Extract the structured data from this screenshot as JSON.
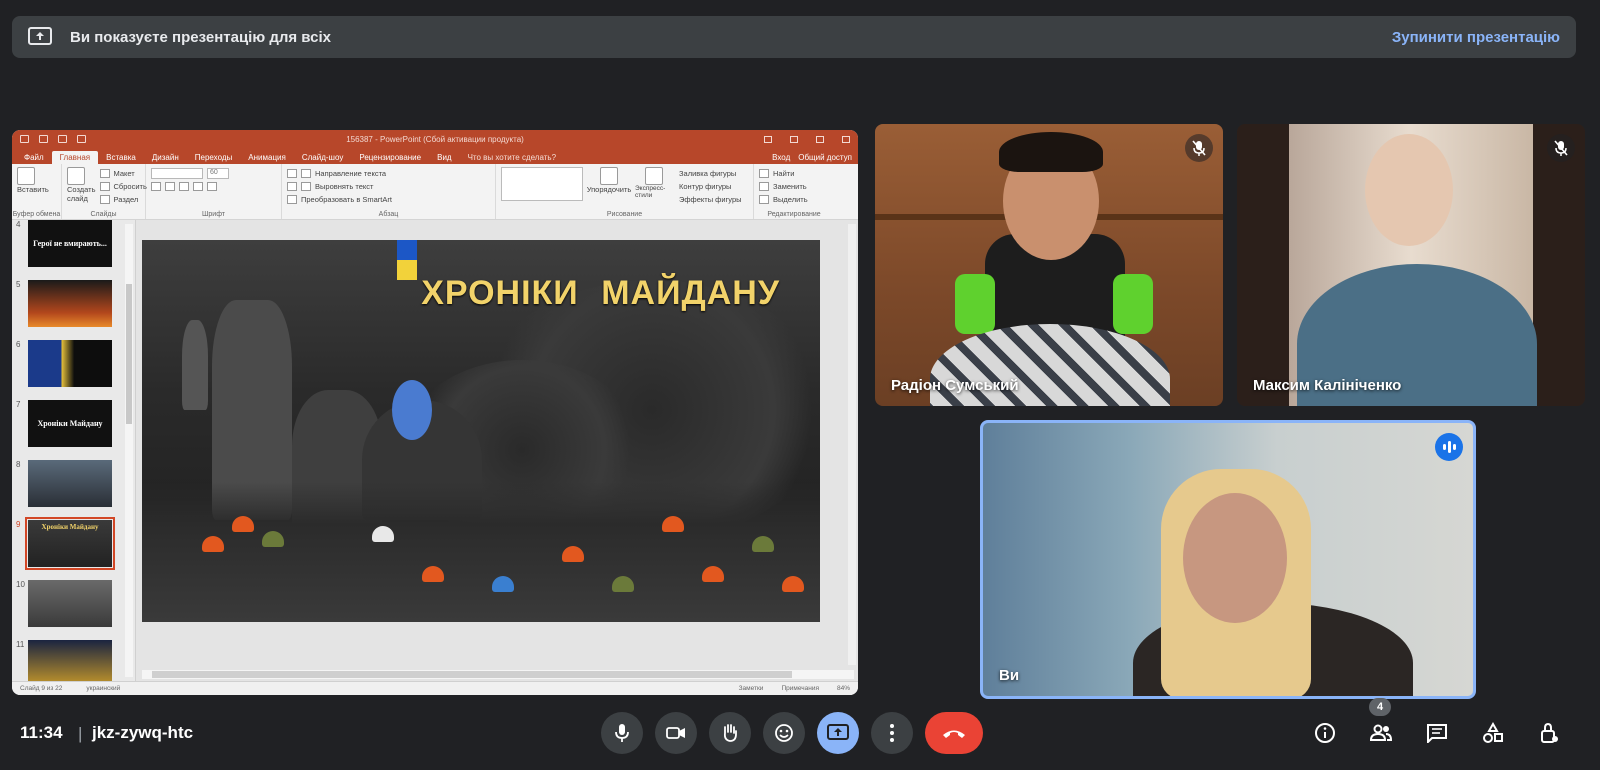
{
  "banner": {
    "text": "Ви показуєте презентацію для всіх",
    "stop_label": "Зупинити презентацію"
  },
  "ppt": {
    "window_title": "156387 - PowerPoint (Сбой активации продукта)",
    "tabs": [
      "Файл",
      "Главная",
      "Вставка",
      "Дизайн",
      "Переходы",
      "Анимация",
      "Слайд-шоу",
      "Рецензирование",
      "Вид"
    ],
    "search_hint": "Что вы хотите сделать?",
    "signin": "Вход",
    "share": "Общий доступ",
    "ribbon": {
      "paste": "Вставить",
      "clipboard": "Буфер обмена",
      "new_slide": "Создать слайд",
      "layout": "Макет",
      "reset": "Сбросить",
      "section": "Раздел",
      "slides_group": "Слайды",
      "font_size": "60",
      "font_group": "Шрифт",
      "text_direction": "Направление текста",
      "align_text": "Выровнять текст",
      "smartart": "Преобразовать в SmartArt",
      "paragraph_group": "Абзац",
      "arrange": "Упорядочить",
      "quick_styles": "Экспресс-стили",
      "shape_fill": "Заливка фигуры",
      "shape_outline": "Контур фигуры",
      "shape_effects": "Эффекты фигуры",
      "drawing_group": "Рисование",
      "find": "Найти",
      "replace": "Заменить",
      "select": "Выделить",
      "editing_group": "Редактирование"
    },
    "thumbnails": [
      {
        "num": "4",
        "text": "Герої не вмирають..."
      },
      {
        "num": "5",
        "text": ""
      },
      {
        "num": "6",
        "text": ""
      },
      {
        "num": "7",
        "text": "Хроніки Майдану"
      },
      {
        "num": "8",
        "text": ""
      },
      {
        "num": "9",
        "text": "Хроніки Майдану"
      },
      {
        "num": "10",
        "text": ""
      },
      {
        "num": "11",
        "text": ""
      }
    ],
    "slide_title": "ХРОНІКИ МАЙДАНУ",
    "status": {
      "slide_info": "Слайд 9 из 22",
      "language": "украинский",
      "notes": "Заметки",
      "comments": "Примечания",
      "zoom": "84%"
    }
  },
  "participants": [
    {
      "name": "Радіон Сумський",
      "muted": true
    },
    {
      "name": "Максим Калініченко",
      "muted": true
    },
    {
      "name": "Ви",
      "speaking": true
    }
  ],
  "bottom": {
    "time": "11:34",
    "separator": "|",
    "meeting_code": "jkz-zywq-htc",
    "participant_count": "4"
  },
  "colors": {
    "background": "#202124",
    "accent": "#8ab4f8",
    "end_call": "#ea4335",
    "ppt_brand": "#b7472a"
  }
}
